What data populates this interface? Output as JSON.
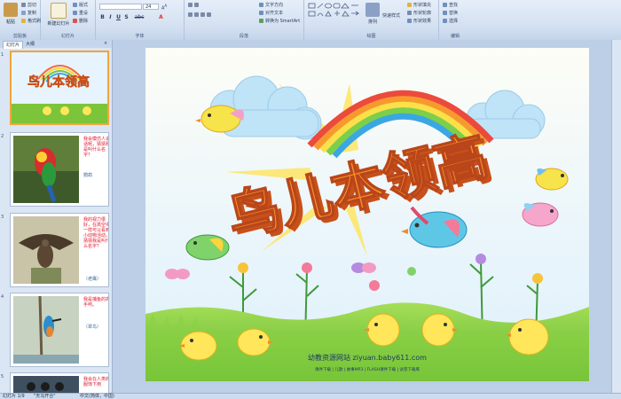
{
  "ribbon": {
    "clipboard": {
      "label": "剪贴板",
      "paste": "粘贴",
      "cut": "剪切",
      "copy": "复制",
      "format_painter": "格式刷"
    },
    "slides": {
      "label": "幻灯片",
      "new_slide": "新建幻灯片",
      "layout": "版式",
      "reset": "重设",
      "delete": "删除"
    },
    "font": {
      "label": "字体",
      "font_size": "24",
      "bold": "B",
      "italic": "I",
      "underline": "U",
      "shadow": "S",
      "strike": "abc"
    },
    "paragraph": {
      "label": "段落",
      "text_direction": "文字方向",
      "align_text": "对齐文本",
      "smartart": "转换为 SmartArt"
    },
    "drawing": {
      "label": "绘图",
      "arrange": "排列",
      "quick_styles": "快速样式",
      "shape_fill": "形状填充",
      "shape_outline": "形状轮廓",
      "shape_effects": "形状效果"
    },
    "editing": {
      "label": "编辑",
      "find": "查找",
      "replace": "替换",
      "select": "选择"
    }
  },
  "leftpane": {
    "tabs": [
      "幻灯片",
      "大纲"
    ],
    "slides": [
      {
        "num": "1",
        "text": ""
      },
      {
        "num": "2",
        "text": "我会模仿人说话呢，猜猜我是叫什么名字？",
        "answer": "鹦鹉"
      },
      {
        "num": "3",
        "text": "我的视力很好，在高空中一样可以看到小动物活动，猜猜我是叫什么名字？",
        "answer": "（老鹰）"
      },
      {
        "num": "4",
        "text": "我是捕鱼的高手哟。",
        "answer": "（翠鸟）"
      },
      {
        "num": "5",
        "text": "我会在人类的服饰下用"
      }
    ]
  },
  "slide": {
    "title": "鸟儿本领高",
    "site_text": "幼教资源网站  ziyuan.baby611.com",
    "footer_links": "课件下载 | 儿歌 | 故事MP3 | FLASH课件下载 | 试卷下载库"
  },
  "thumb_title": "鸟儿本领高",
  "statusbar": {
    "slide_info": "幻灯片 1/9",
    "theme": "\"天马开合\"",
    "language": "中文(简体，中国)"
  },
  "colors": {
    "title_orange": "#f2841e",
    "title_shadow": "#c8501a",
    "sky": "#dff0fb",
    "grass": "#7cc53a",
    "chick": "#ffe65a",
    "ribbon_bg": "#dbe6f4",
    "thumb_text": "#e1142a"
  }
}
